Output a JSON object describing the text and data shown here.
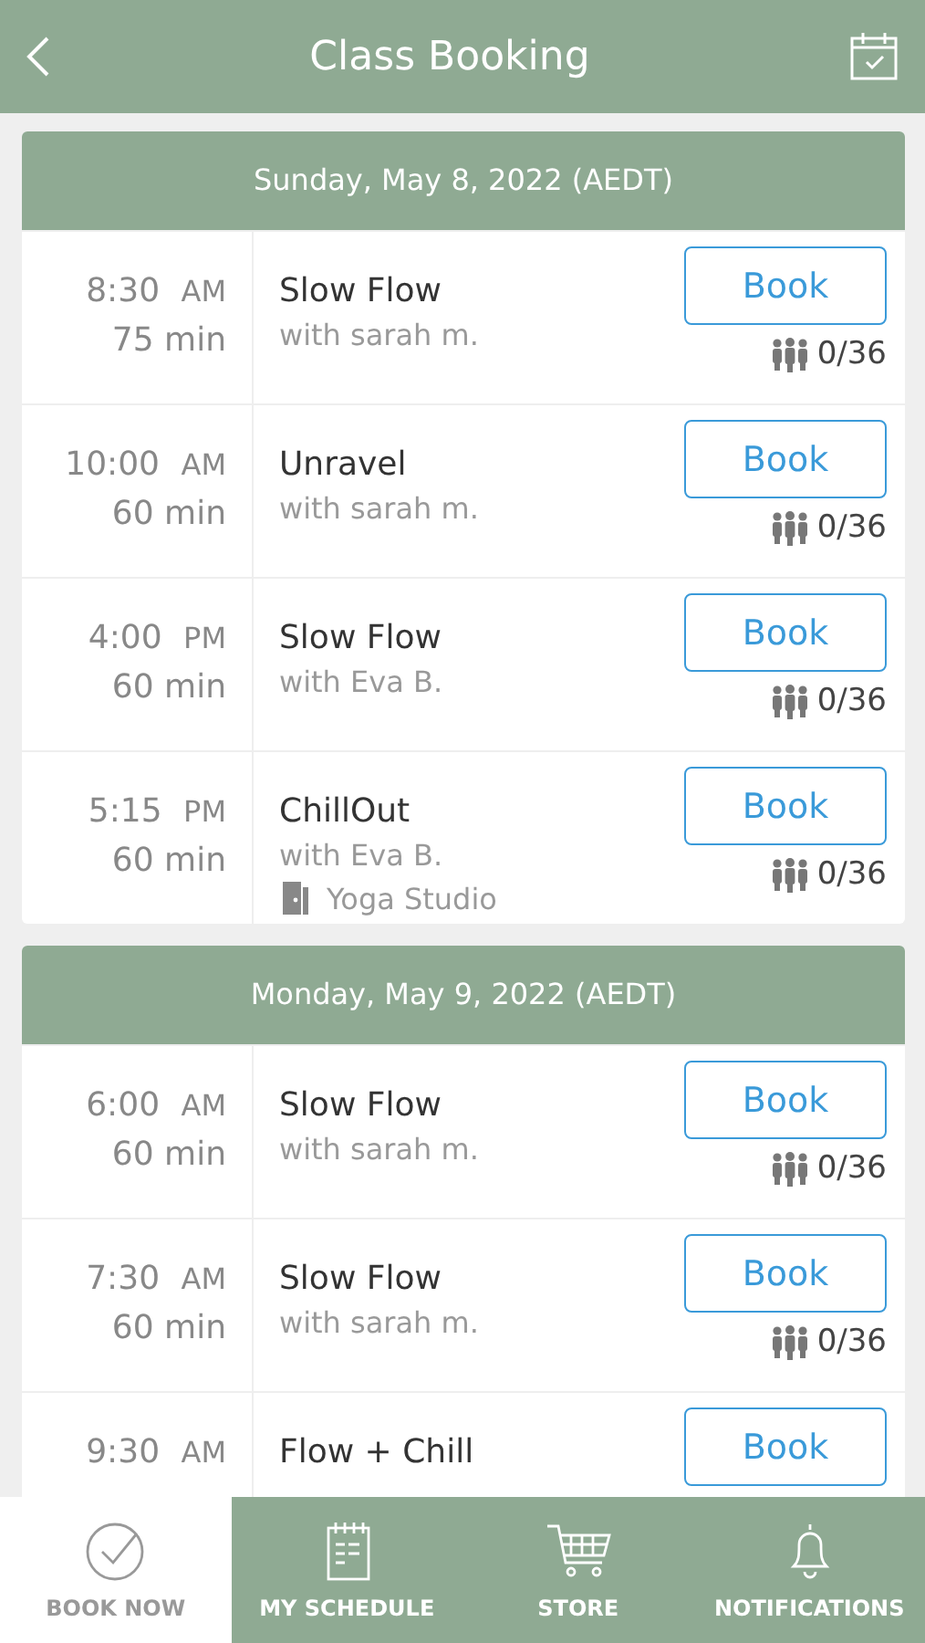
{
  "header": {
    "title": "Class Booking"
  },
  "days": [
    {
      "title": "Sunday, May 8, 2022 (AEDT)",
      "classes": [
        {
          "time": "8:30",
          "period": "AM",
          "duration": "75 min",
          "name": "Slow Flow",
          "instructor": "with sarah m.",
          "button": "Book",
          "capacity": "0/36"
        },
        {
          "time": "10:00",
          "period": "AM",
          "duration": "60 min",
          "name": "Unravel",
          "instructor": "with sarah m.",
          "button": "Book",
          "capacity": "0/36"
        },
        {
          "time": "4:00",
          "period": "PM",
          "duration": "60 min",
          "name": "Slow Flow",
          "instructor": "with Eva B.",
          "button": "Book",
          "capacity": "0/36"
        },
        {
          "time": "5:15",
          "period": "PM",
          "duration": "60 min",
          "name": "ChillOut",
          "instructor": "with Eva B.",
          "location": "Yoga Studio",
          "button": "Book",
          "capacity": "0/36"
        }
      ]
    },
    {
      "title": "Monday, May 9, 2022 (AEDT)",
      "classes": [
        {
          "time": "6:00",
          "period": "AM",
          "duration": "60 min",
          "name": "Slow Flow",
          "instructor": "with sarah m.",
          "button": "Book",
          "capacity": "0/36"
        },
        {
          "time": "7:30",
          "period": "AM",
          "duration": "60 min",
          "name": "Slow Flow",
          "instructor": "with sarah m.",
          "button": "Book",
          "capacity": "0/36"
        },
        {
          "time": "9:30",
          "period": "AM",
          "name": "Flow + Chill",
          "button": "Book"
        }
      ]
    }
  ],
  "tabs": [
    {
      "kind": "check",
      "label": "BOOK NOW",
      "selected": true
    },
    {
      "kind": "schedule",
      "label": "MY SCHEDULE",
      "selected": false
    },
    {
      "kind": "cart",
      "label": "STORE",
      "selected": false
    },
    {
      "kind": "bell",
      "label": "NOTIFICATIONS",
      "selected": false
    }
  ]
}
